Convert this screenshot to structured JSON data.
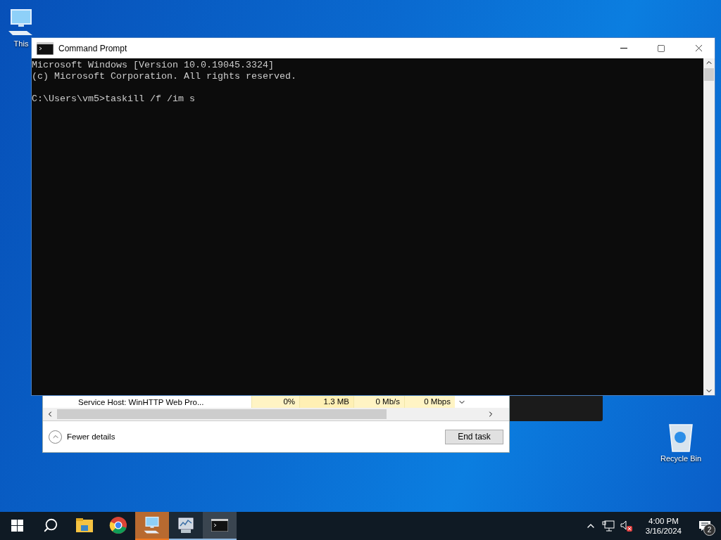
{
  "desktop_icons": [
    {
      "kind": "computer",
      "label": "This"
    },
    {
      "kind": "recycle",
      "label": "Recycle Bin"
    }
  ],
  "task_manager": {
    "rows": [
      {
        "name": "Service Host: WinHTTP Web Pro...",
        "cpu": "0%",
        "memory": "1.3 MB",
        "disk": "0 Mb/s",
        "network": "0 Mbps"
      }
    ],
    "fewer_details": "Fewer details",
    "end_task": "End task"
  },
  "command_prompt": {
    "title": "Command Prompt",
    "paragraphs": [
      [
        "Microsoft Windows [Version 10.0.19045.3324]",
        "(c) Microsoft Corporation. All rights reserved."
      ],
      [
        "C:\\Users\\vm5>taskill /f /im s"
      ]
    ]
  },
  "taskbar": {
    "apps": [
      {
        "kind": "explorer",
        "running": false,
        "attention": false,
        "selected": false
      },
      {
        "kind": "chrome",
        "running": false,
        "attention": false,
        "selected": false
      },
      {
        "kind": "computer",
        "running": true,
        "attention": true,
        "selected": false
      },
      {
        "kind": "monitor",
        "running": true,
        "attention": false,
        "selected": false
      },
      {
        "kind": "console",
        "running": true,
        "attention": false,
        "selected": true
      }
    ],
    "volume_muted": true,
    "clock": {
      "time": "4:00 PM",
      "date": "3/16/2024"
    },
    "notifications": {
      "count": "2"
    }
  }
}
